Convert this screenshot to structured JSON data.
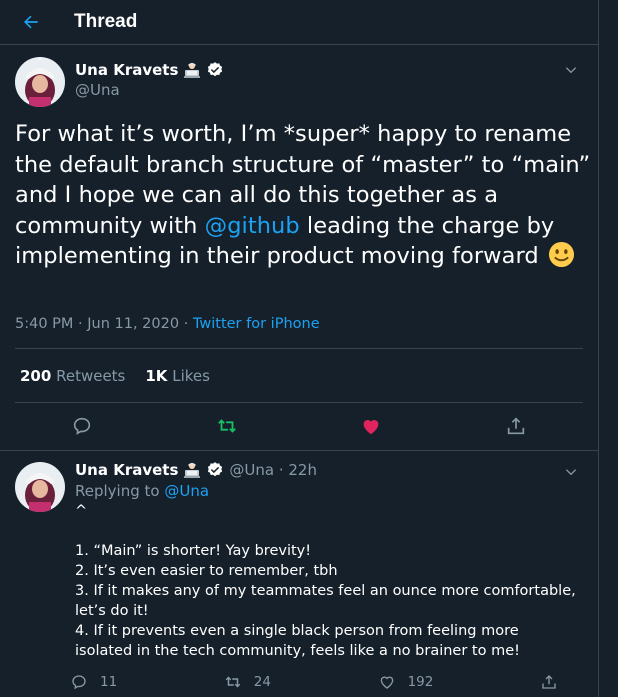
{
  "header": {
    "title": "Thread"
  },
  "main_tweet": {
    "name": "Una Kravets",
    "handle": "@Una",
    "text_pre": "For what it’s worth, I’m *super* happy to rename the default branch structure of “master” to “main” and I hope we can all do this together as a community with ",
    "mention": "@github",
    "text_post": " leading the charge by implementing in their product moving forward",
    "time": "5:40 PM · Jun 11, 2020 · ",
    "source": "Twitter for iPhone",
    "retweets_count": "200",
    "retweets_label": "Retweets",
    "likes_count": "1K",
    "likes_label": "Likes"
  },
  "reply_tweet": {
    "name": "Una Kravets",
    "handle_time": "@Una · 22h",
    "replying_prefix": "Replying to ",
    "replying_to": "@Una",
    "body": "^\n\n1. “Main” is shorter! Yay brevity!\n2. It’s even easier to remember, tbh\n3. If it makes any of my teammates feel an ounce more comfortable, let’s do it!\n4. If it prevents even a single black person from feeling more isolated in the tech community, feels like a no brainer to me!",
    "reply_count": "11",
    "retweet_count": "24",
    "like_count": "192"
  },
  "colors": {
    "background": "#15202b",
    "accent": "#1da1f2",
    "muted": "#8899a6",
    "retweeted": "#17bf63",
    "liked": "#e0245e",
    "border": "#38444d"
  }
}
